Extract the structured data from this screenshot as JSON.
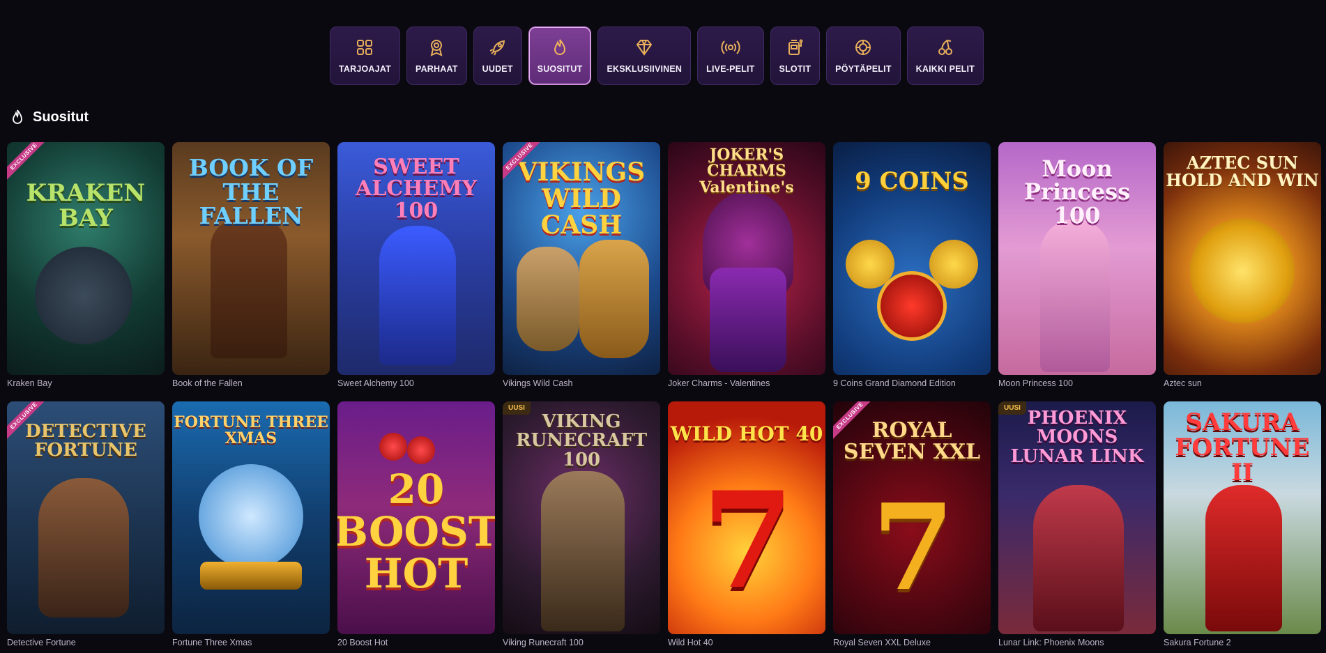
{
  "tabs": [
    {
      "label": "TARJOAJAT",
      "icon": "grid-icon",
      "active": false
    },
    {
      "label": "PARHAAT",
      "icon": "award-icon",
      "active": false
    },
    {
      "label": "UUDET",
      "icon": "rocket-icon",
      "active": false
    },
    {
      "label": "SUOSITUT",
      "icon": "flame-icon",
      "active": true
    },
    {
      "label": "EKSKLUSIIVINEN",
      "icon": "diamond-icon",
      "active": false
    },
    {
      "label": "LIVE-PELIT",
      "icon": "broadcast-icon",
      "active": false
    },
    {
      "label": "SLOTIT",
      "icon": "slot-machine-icon",
      "active": false
    },
    {
      "label": "PÖYTÄPELIT",
      "icon": "chip-icon",
      "active": false
    },
    {
      "label": "KAIKKI PELIT",
      "icon": "cherries-icon",
      "active": false
    }
  ],
  "section": {
    "title": "Suositut",
    "icon": "flame-icon"
  },
  "badges": {
    "exclusive": "EXCLUSIVE",
    "new": "UUSI"
  },
  "games": [
    {
      "name": "Kraken Bay",
      "art_text": "KRAKEN BAY",
      "badge": "exclusive"
    },
    {
      "name": "Book of the Fallen",
      "art_text": "BOOK OF THE FALLEN",
      "badge": ""
    },
    {
      "name": "Sweet Alchemy 100",
      "art_text": "SWEET ALCHEMY 100",
      "badge": ""
    },
    {
      "name": "Vikings Wild Cash",
      "art_text": "VIKINGS WILD CASH",
      "badge": "exclusive"
    },
    {
      "name": "Joker Charms - Valentines",
      "art_text": "JOKER'S CHARMS Valentine's",
      "badge": ""
    },
    {
      "name": "9 Coins Grand Diamond Edition",
      "art_text": "9 COINS",
      "badge": ""
    },
    {
      "name": "Moon Princess 100",
      "art_text": "Moon Princess 100",
      "badge": ""
    },
    {
      "name": "Aztec sun",
      "art_text": "AZTEC SUN HOLD AND WIN",
      "badge": ""
    },
    {
      "name": "Detective Fortune",
      "art_text": "DETECTIVE FORTUNE",
      "badge": "exclusive"
    },
    {
      "name": "Fortune Three Xmas",
      "art_text": "FORTUNE THREE XMAS",
      "badge": ""
    },
    {
      "name": "20 Boost Hot",
      "art_text": "20 BOOST HOT",
      "badge": ""
    },
    {
      "name": "Viking Runecraft 100",
      "art_text": "VIKING RUNECRAFT 100",
      "badge": "new"
    },
    {
      "name": "Wild Hot 40",
      "art_text": "WILD HOT 40",
      "badge": ""
    },
    {
      "name": "Royal Seven XXL Deluxe",
      "art_text": "ROYAL SEVEN XXL",
      "badge": "exclusive"
    },
    {
      "name": "Lunar Link: Phoenix Moons",
      "art_text": "PHOENIX MOONS LUNAR LINK",
      "badge": "new"
    },
    {
      "name": "Sakura Fortune 2",
      "art_text": "SAKURA FORTUNE II",
      "badge": ""
    }
  ],
  "colors": {
    "background": "#0b0910",
    "tab_bg": "#22143a",
    "tab_active_bg": "#6e3487",
    "accent": "#c27fd6",
    "exclusive_ribbon": "#c63a86",
    "new_badge": "#f5c04a"
  }
}
